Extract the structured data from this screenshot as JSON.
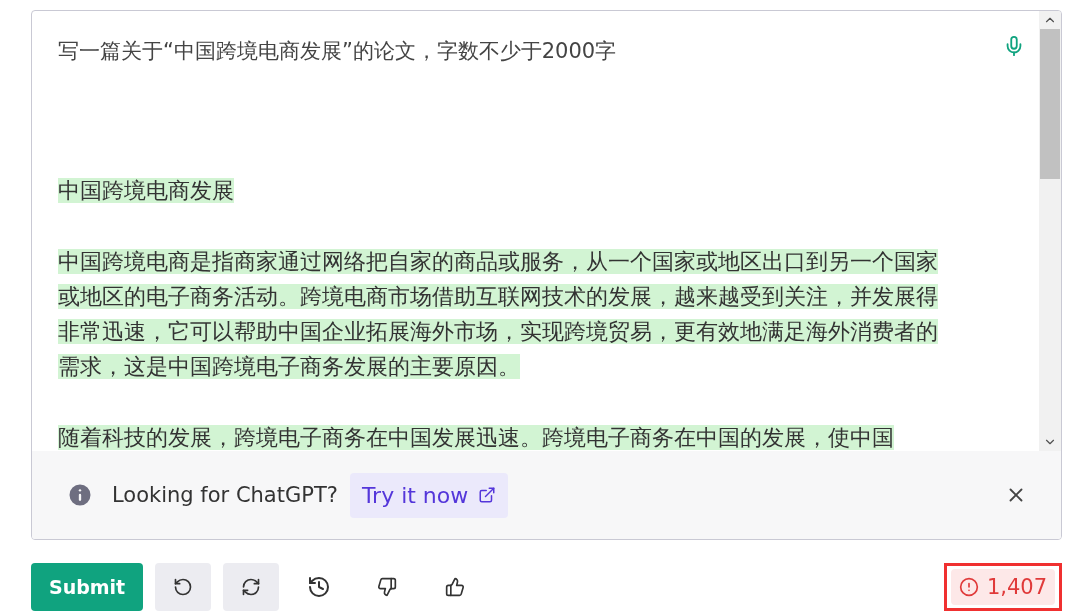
{
  "editor": {
    "prompt": "写一篇关于“中国跨境电商发展”的论文，字数不少于2000字",
    "paragraphs": [
      {
        "text": "中国跨境电商发展",
        "highlighted": true
      },
      {
        "text": "中国跨境电商是指商家通过网络把自家的商品或服务，从一个国家或地区出口到另一个国家或地区的电子商务活动。跨境电商市场借助互联网技术的发展，越来越受到关注，并发展得非常迅速，它可以帮助中国企业拓展海外市场，实现跨境贸易，更有效地满足海外消费者的需求，这是中国跨境电子商务发展的主要原因。",
        "highlighted": true
      },
      {
        "text": "随着科技的发展，跨境电子商务在中国发展迅速。跨境电子商务在中国的发展，使中国",
        "highlighted": true
      }
    ]
  },
  "banner": {
    "message": "Looking for ChatGPT?",
    "link": "Try it now"
  },
  "toolbar": {
    "submit": "Submit",
    "counter": "1,407",
    "counter_highlighted": true
  }
}
